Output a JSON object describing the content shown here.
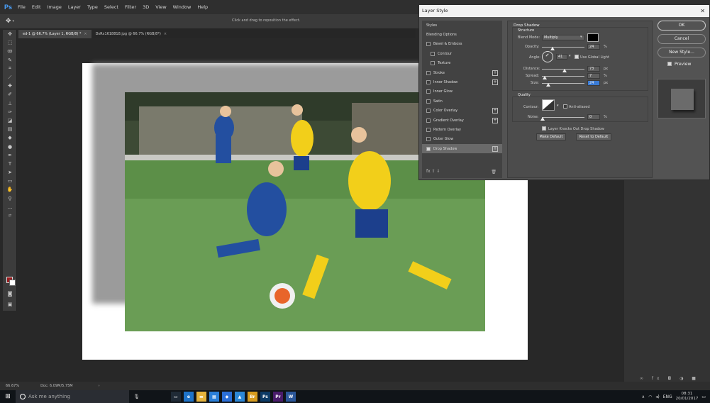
{
  "app": {
    "logo": "Ps"
  },
  "menu": [
    "File",
    "Edit",
    "Image",
    "Layer",
    "Type",
    "Select",
    "Filter",
    "3D",
    "View",
    "Window",
    "Help"
  ],
  "options_bar": {
    "hint": "Click and drag to reposition the effect."
  },
  "doc_tabs": [
    {
      "label": "ed-1 @ 66.7% (Layer 1, RGB/8) *"
    },
    {
      "label": "DsRx1618818.jpg @ 66.7% (RGB/8*)"
    }
  ],
  "status": {
    "zoom": "66.67%",
    "doc": "Doc: 6.09M/5.75M"
  },
  "dialog": {
    "title": "Layer Style",
    "styles": [
      {
        "label": "Styles",
        "checkbox": false,
        "checked": false,
        "plus": false
      },
      {
        "label": "Blending Options",
        "checkbox": false,
        "checked": false,
        "plus": false
      },
      {
        "label": "Bevel & Emboss",
        "checkbox": true,
        "checked": false,
        "plus": false
      },
      {
        "label": "Contour",
        "checkbox": true,
        "checked": false,
        "plus": false,
        "indent": true
      },
      {
        "label": "Texture",
        "checkbox": true,
        "checked": false,
        "plus": false,
        "indent": true
      },
      {
        "label": "Stroke",
        "checkbox": true,
        "checked": false,
        "plus": true
      },
      {
        "label": "Inner Shadow",
        "checkbox": true,
        "checked": false,
        "plus": true
      },
      {
        "label": "Inner Glow",
        "checkbox": true,
        "checked": false,
        "plus": false
      },
      {
        "label": "Satin",
        "checkbox": true,
        "checked": false,
        "plus": false
      },
      {
        "label": "Color Overlay",
        "checkbox": true,
        "checked": false,
        "plus": true
      },
      {
        "label": "Gradient Overlay",
        "checkbox": true,
        "checked": false,
        "plus": true
      },
      {
        "label": "Pattern Overlay",
        "checkbox": true,
        "checked": false,
        "plus": false
      },
      {
        "label": "Outer Glow",
        "checkbox": true,
        "checked": false,
        "plus": false
      },
      {
        "label": "Drop Shadow",
        "checkbox": true,
        "checked": true,
        "plus": true,
        "selected": true
      }
    ],
    "fx_bar": "fx  ⇧  ⇩",
    "settings": {
      "section": "Drop Shadow",
      "structure": "Structure",
      "blend_mode_label": "Blend Mode:",
      "blend_mode": "Multiply",
      "shadow_color": "#000000",
      "opacity_label": "Opacity:",
      "opacity": "24",
      "opacity_unit": "%",
      "angle_label": "Angle:",
      "angle": "41",
      "use_global_light": "Use Global Light",
      "distance_label": "Distance:",
      "distance": "73",
      "distance_unit": "px",
      "spread_label": "Spread:",
      "spread": "7",
      "spread_unit": "%",
      "size_label": "Size:",
      "size": "24",
      "size_unit": "px",
      "quality": "Quality",
      "contour_label": "Contour:",
      "anti_aliased": "Anti-aliased",
      "noise_label": "Noise:",
      "noise": "0",
      "noise_unit": "%",
      "knockout": "Layer Knocks Out Drop Shadow",
      "make_default": "Make Default",
      "reset_default": "Reset to Default"
    },
    "buttons": {
      "ok": "OK",
      "cancel": "Cancel",
      "new_style": "New Style...",
      "preview": "Preview"
    }
  },
  "taskbar": {
    "search_placeholder": "Ask me anything",
    "apps": [
      {
        "name": "task-view",
        "label": "▭",
        "color": "#1f2a36"
      },
      {
        "name": "edge",
        "label": "e",
        "color": "#1e73c8"
      },
      {
        "name": "file-explorer",
        "label": "▬",
        "color": "#e3b23c"
      },
      {
        "name": "store",
        "label": "▦",
        "color": "#2b7fd8"
      },
      {
        "name": "security",
        "label": "◆",
        "color": "#2b6fd8"
      },
      {
        "name": "photos",
        "label": "▲",
        "color": "#2c87d6"
      },
      {
        "name": "bridge",
        "label": "Br",
        "color": "#d69b1e"
      },
      {
        "name": "photoshop",
        "label": "Ps",
        "color": "#0d3b66"
      },
      {
        "name": "premiere",
        "label": "Pr",
        "color": "#4a1c6b"
      },
      {
        "name": "word",
        "label": "W",
        "color": "#2b579a"
      }
    ],
    "time": "08:31",
    "date": "20/01/2017"
  }
}
